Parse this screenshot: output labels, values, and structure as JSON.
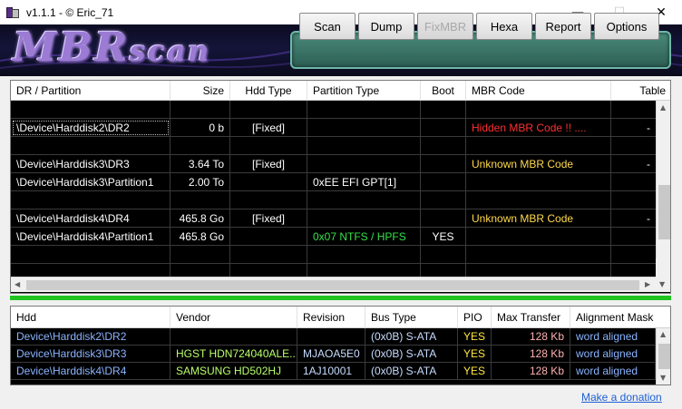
{
  "window": {
    "title": "v1.1.1 - © Eric_71",
    "minimize": "—",
    "maximize": "☐",
    "close": "✕"
  },
  "banner": {
    "logo_main": "MBR",
    "logo_small": "scan"
  },
  "toolbar": {
    "scan": "Scan",
    "dump": "Dump",
    "fixmbr": "FixMBR",
    "hexa": "Hexa",
    "report": "Report",
    "options": "Options"
  },
  "partitions": {
    "headers": [
      "DR / Partition",
      "Size",
      "Hdd Type",
      "Partition Type",
      "Boot",
      "MBR Code",
      "Table"
    ],
    "rows": [
      [
        "",
        "",
        "",
        "",
        "",
        "",
        ""
      ],
      [
        "\\Device\\Harddisk2\\DR2",
        "0 b",
        "[Fixed]",
        "",
        "",
        "Hidden MBR Code !! ....",
        "-"
      ],
      [
        "",
        "",
        "",
        "",
        "",
        "",
        ""
      ],
      [
        "\\Device\\Harddisk3\\DR3",
        "3.64 To",
        "[Fixed]",
        "",
        "",
        "Unknown MBR Code",
        "-"
      ],
      [
        "\\Device\\Harddisk3\\Partition1",
        "2.00 To",
        "",
        "0xEE EFI GPT[1]",
        "",
        "",
        ""
      ],
      [
        "",
        "",
        "",
        "",
        "",
        "",
        ""
      ],
      [
        "\\Device\\Harddisk4\\DR4",
        "465.8 Go",
        "[Fixed]",
        "",
        "",
        "Unknown MBR Code",
        "-"
      ],
      [
        "\\Device\\Harddisk4\\Partition1",
        "465.8 Go",
        "",
        "0x07 NTFS / HPFS",
        "YES",
        "",
        ""
      ],
      [
        "",
        "",
        "",
        "",
        "",
        "",
        ""
      ],
      [
        "",
        "",
        "",
        "",
        "",
        "",
        ""
      ]
    ]
  },
  "disks": {
    "headers": [
      "Hdd",
      "Vendor",
      "Revision",
      "Bus Type",
      "PIO",
      "Max Transfer",
      "Alignment Mask"
    ],
    "rows": [
      [
        "Device\\Harddisk2\\DR2",
        "",
        "",
        "(0x0B)  S-ATA",
        "YES",
        "128 Kb",
        "word aligned"
      ],
      [
        "Device\\Harddisk3\\DR3",
        "HGST HDN724040ALE...",
        "MJAOA5E0",
        "(0x0B)  S-ATA",
        "YES",
        "128 Kb",
        "word aligned"
      ],
      [
        "Device\\Harddisk4\\DR4",
        "SAMSUNG HD502HJ",
        "1AJ10001",
        "(0x0B)  S-ATA",
        "YES",
        "128 Kb",
        "word aligned"
      ]
    ]
  },
  "donate_link": "Make a donation"
}
